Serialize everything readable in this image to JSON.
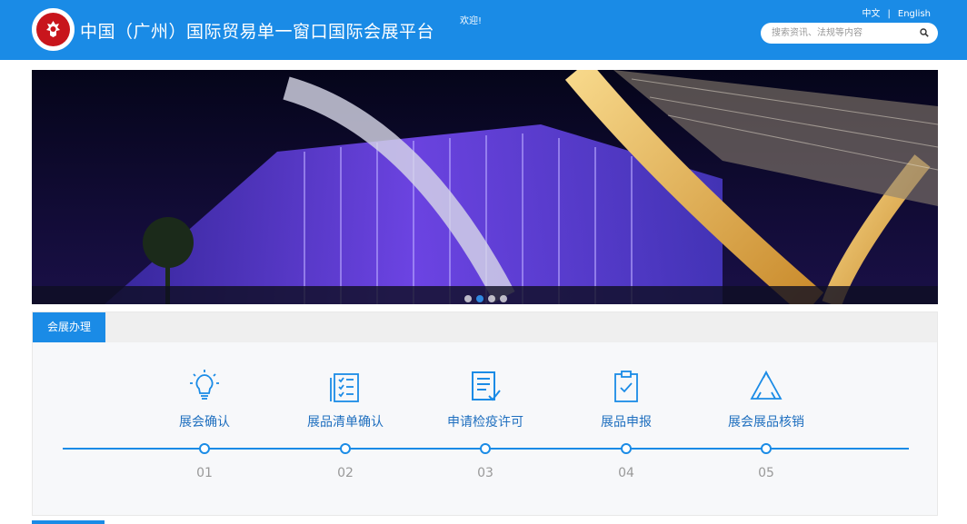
{
  "header": {
    "title": "中国（广州）国际贸易单一窗口国际会展平台",
    "welcome": "欢迎!",
    "lang_zh": "中文",
    "lang_sep": "|",
    "lang_en": "English",
    "search_placeholder": "搜索资讯、法规等内容",
    "brand_color": "#1a8be6",
    "logo_color": "#c8151c"
  },
  "banner": {
    "slides": 4,
    "active_slide": 2
  },
  "section": {
    "tab_label": "会展办理",
    "steps": [
      {
        "label": "展会确认",
        "number": "01",
        "icon": "lightbulb-icon"
      },
      {
        "label": "展品清单确认",
        "number": "02",
        "icon": "checklist-icon"
      },
      {
        "label": "申请检疫许可",
        "number": "03",
        "icon": "document-check-icon"
      },
      {
        "label": "展品申报",
        "number": "04",
        "icon": "clipboard-check-icon"
      },
      {
        "label": "展会展品核销",
        "number": "05",
        "icon": "recycle-icon"
      }
    ]
  }
}
